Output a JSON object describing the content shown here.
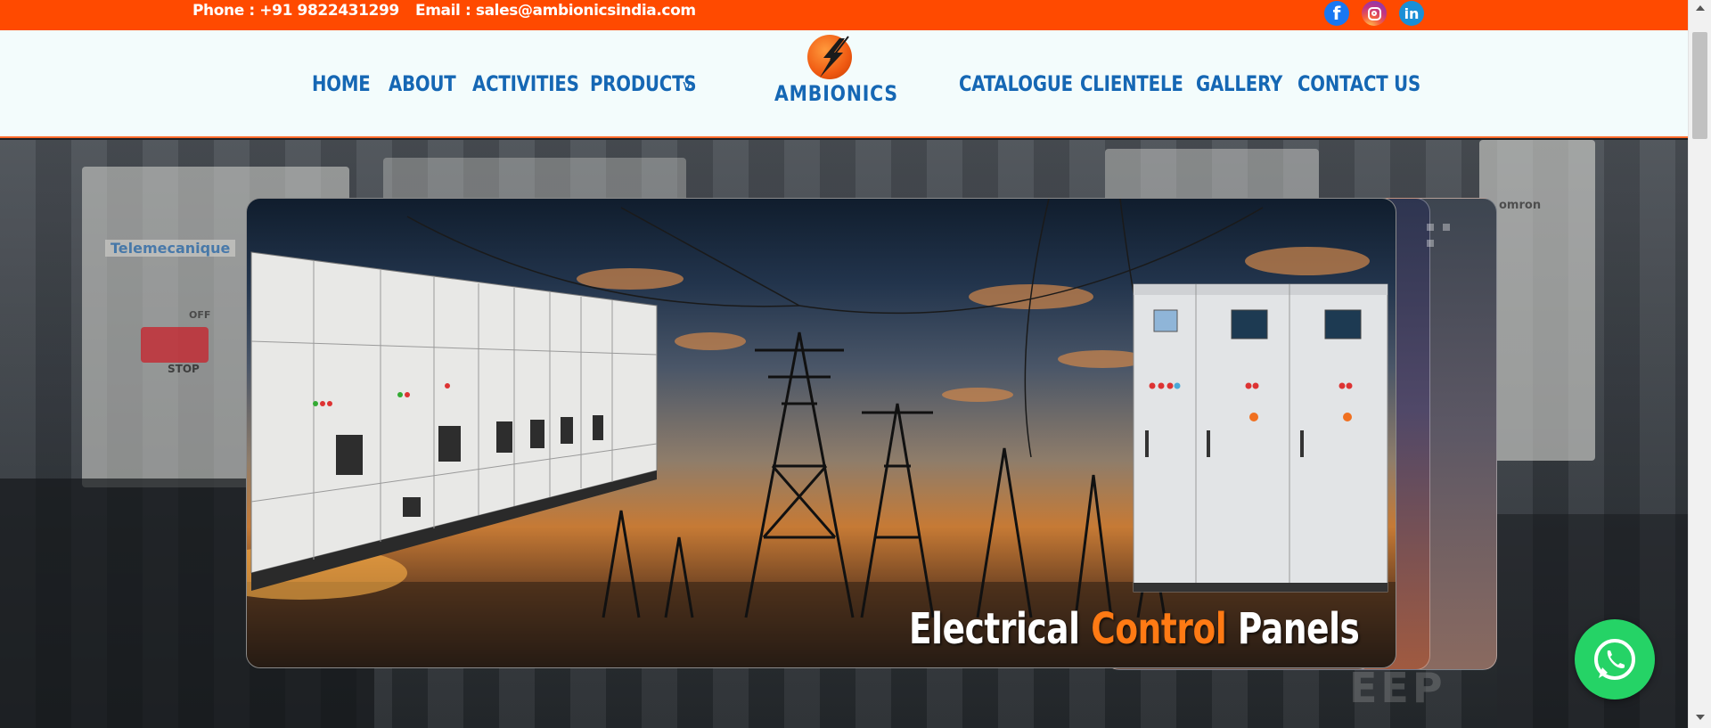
{
  "topbar": {
    "phone": "Phone : +91 9822431299",
    "email": "Email : sales@ambionicsindia.com",
    "social": [
      "facebook-icon",
      "instagram-icon",
      "linkedin-icon"
    ]
  },
  "brand": {
    "name": "AMBIONICS"
  },
  "nav": {
    "left": [
      "HOME",
      "ABOUT",
      "ACTIVITIES",
      "PRODUCTS"
    ],
    "products_caret": "v",
    "right": [
      "CATALOGUE",
      "CLIENTELE",
      "GALLERY",
      "CONTACT US"
    ]
  },
  "hero": {
    "caption_start": "Electrical ",
    "caption_accent": "Control",
    "caption_end": " Panels",
    "background_labels": [
      "Telemecanique",
      "STOP",
      "OFF",
      "omron",
      "EEP"
    ]
  },
  "colors": {
    "topbar": "#ff4a00",
    "nav_text": "#1567b4",
    "header_bg": "#f3fcfc",
    "accent": "#ff7a14",
    "whatsapp": "#25d366"
  },
  "icons": {
    "whatsapp": "whatsapp-icon"
  }
}
